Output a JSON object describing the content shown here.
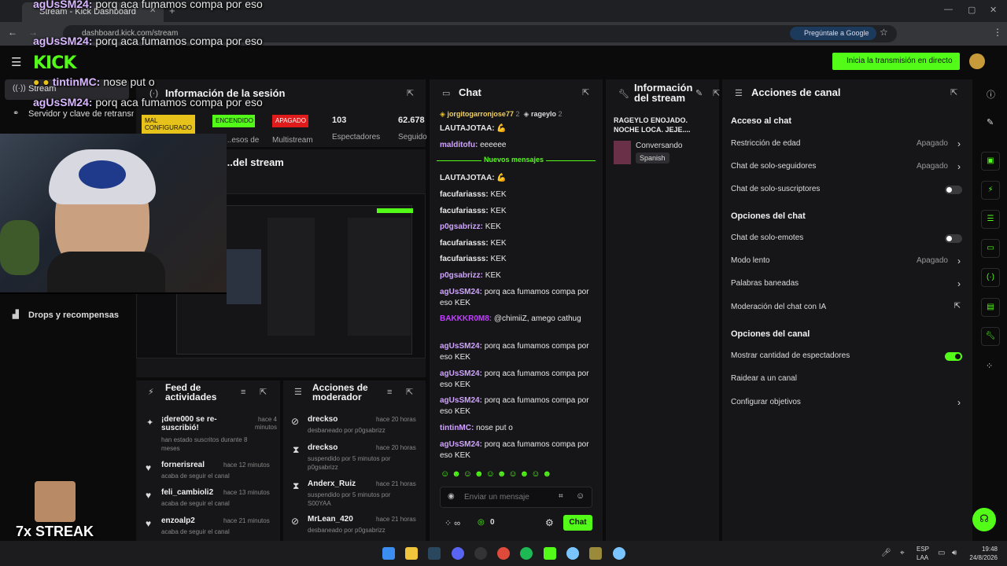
{
  "browser": {
    "tab_title": "Stream - Kick Dashboard",
    "url": "dashboard.kick.com/stream",
    "ask_google": "Pregúntale a Google"
  },
  "header": {
    "logo": "KICK",
    "go_live": "Inicia la transmisión en directo"
  },
  "sidebar": {
    "items": [
      {
        "label": "Stream"
      },
      {
        "label": "Servidor y clave de retransmisión"
      },
      {
        "label": "Drops y recompensas"
      }
    ]
  },
  "session": {
    "title": "Información de la sesión",
    "stats": [
      {
        "badge": "MAL CONFIGURADO",
        "label": ""
      },
      {
        "badge": "ENCENDIDO",
        "label": "...esos de"
      },
      {
        "badge": "APAGADO",
        "label": "Multistream"
      },
      {
        "value": "103",
        "label": "Espectadores"
      },
      {
        "value": "62.678",
        "label": "Seguido"
      }
    ],
    "preview_title": "...del stream"
  },
  "chat": {
    "title": "Chat",
    "pinned": [
      {
        "user": "jorgitogarronjose77",
        "count": "2"
      },
      {
        "user": "rageylo",
        "count": "2"
      }
    ],
    "new_messages": "Nuevos mensajes",
    "messages": [
      {
        "user": "LAUTAJOTAA:",
        "text": "💪"
      },
      {
        "user": "malditofu:",
        "text": "eeeeee"
      },
      {
        "user": "LAUTAJOTAA:",
        "text": "💪"
      },
      {
        "user": "facufariasss:",
        "text": "KEK"
      },
      {
        "user": "facufariasss:",
        "text": "KEK"
      },
      {
        "user": "p0gsabrizz:",
        "text": "KEK"
      },
      {
        "user": "facufariasss:",
        "text": "KEK"
      },
      {
        "user": "facufariasss:",
        "text": "KEK"
      },
      {
        "user": "p0gsabrizz:",
        "text": "KEK"
      },
      {
        "user": "agUsSM24:",
        "text": "porq aca fumamos compa por eso KEK"
      },
      {
        "user": "BAKKKR0M8:",
        "text": "@chimiiZ, amego cathug"
      },
      {
        "user": "agUsSM24:",
        "text": "porq aca fumamos compa por eso KEK"
      },
      {
        "user": "agUsSM24:",
        "text": "porq aca fumamos compa por eso KEK"
      },
      {
        "user": "agUsSM24:",
        "text": "porq aca fumamos compa por eso KEK"
      },
      {
        "user": "tintinMC:",
        "text": "nose put o"
      },
      {
        "user": "agUsSM24:",
        "text": "porq aca fumamos compa por eso KEK"
      }
    ],
    "input_placeholder": "Enviar un mensaje",
    "points": "0",
    "send_label": "Chat"
  },
  "stream_info": {
    "title": "Información del stream",
    "stream_title": "RAGEYLO ENOJADO. NOCHE LOCA. JEJE....",
    "category": "Conversando",
    "language": "Spanish"
  },
  "channel_actions": {
    "title": "Acciones de canal",
    "sections": [
      {
        "heading": "Acceso al chat",
        "rows": [
          {
            "label": "Restricción de edad",
            "value": "Apagado",
            "kind": "link"
          },
          {
            "label": "Chat de solo-seguidores",
            "value": "Apagado",
            "kind": "link"
          },
          {
            "label": "Chat de solo-suscriptores",
            "value": "",
            "kind": "toggle-off"
          }
        ]
      },
      {
        "heading": "Opciones del chat",
        "rows": [
          {
            "label": "Chat de solo-emotes",
            "value": "",
            "kind": "toggle-off"
          },
          {
            "label": "Modo lento",
            "value": "Apagado",
            "kind": "link"
          },
          {
            "label": "Palabras baneadas",
            "value": "",
            "kind": "link"
          },
          {
            "label": "Moderación del chat con IA",
            "value": "",
            "kind": "external"
          }
        ]
      },
      {
        "heading": "Opciones del canal",
        "rows": [
          {
            "label": "Mostrar cantidad de espectadores",
            "value": "",
            "kind": "toggle-on"
          },
          {
            "label": "Raidear a un canal",
            "value": "",
            "kind": "none"
          },
          {
            "label": "Configurar objetivos",
            "value": "",
            "kind": "link"
          }
        ]
      }
    ]
  },
  "activity_feed": {
    "title": "Feed de actividades",
    "items": [
      {
        "name": "¡dere000 se re-suscribió!",
        "sub": "han estado suscritos durante 8 meses",
        "time": "hace 4 minutos"
      },
      {
        "name": "fornerisreal",
        "sub": "acaba de seguir el canal",
        "time": "hace 12 minutos"
      },
      {
        "name": "feli_cambioli2",
        "sub": "acaba de seguir el canal",
        "time": "hace 13 minutos"
      },
      {
        "name": "enzoalp2",
        "sub": "acaba de seguir el canal",
        "time": "hace 21 minutos"
      }
    ]
  },
  "mod_actions": {
    "title": "Acciones de moderador",
    "items": [
      {
        "name": "dreckso",
        "sub": "desbaneado por p0gsabrizz",
        "time": "hace 20 horas"
      },
      {
        "name": "dreckso",
        "sub": "suspendido por 5 minutos por p0gsabrizz",
        "time": "hace 20 horas"
      },
      {
        "name": "Anderx_Ruiz",
        "sub": "suspendido por 5 minutos por S00YAA",
        "time": "hace 21 horas"
      },
      {
        "name": "MrLean_420",
        "sub": "desbaneado por p0gsabrizz",
        "time": "hace 21 horas"
      }
    ]
  },
  "overlay": {
    "messages": [
      {
        "user": "agUsSM24:",
        "text": "porq aca fumamos compa por eso"
      },
      {
        "user": "agUsSM24:",
        "text": "porq aca fumamos compa por eso"
      },
      {
        "user": "tintinMC:",
        "text": "nose put o"
      },
      {
        "user": "agUsSM24:",
        "text": "porq aca fumamos compa por eso"
      }
    ],
    "streak": "7x STREAK"
  },
  "taskbar": {
    "lang": "ESP",
    "lang2": "LAA",
    "time": "19:48",
    "date": "24/8/2026"
  }
}
